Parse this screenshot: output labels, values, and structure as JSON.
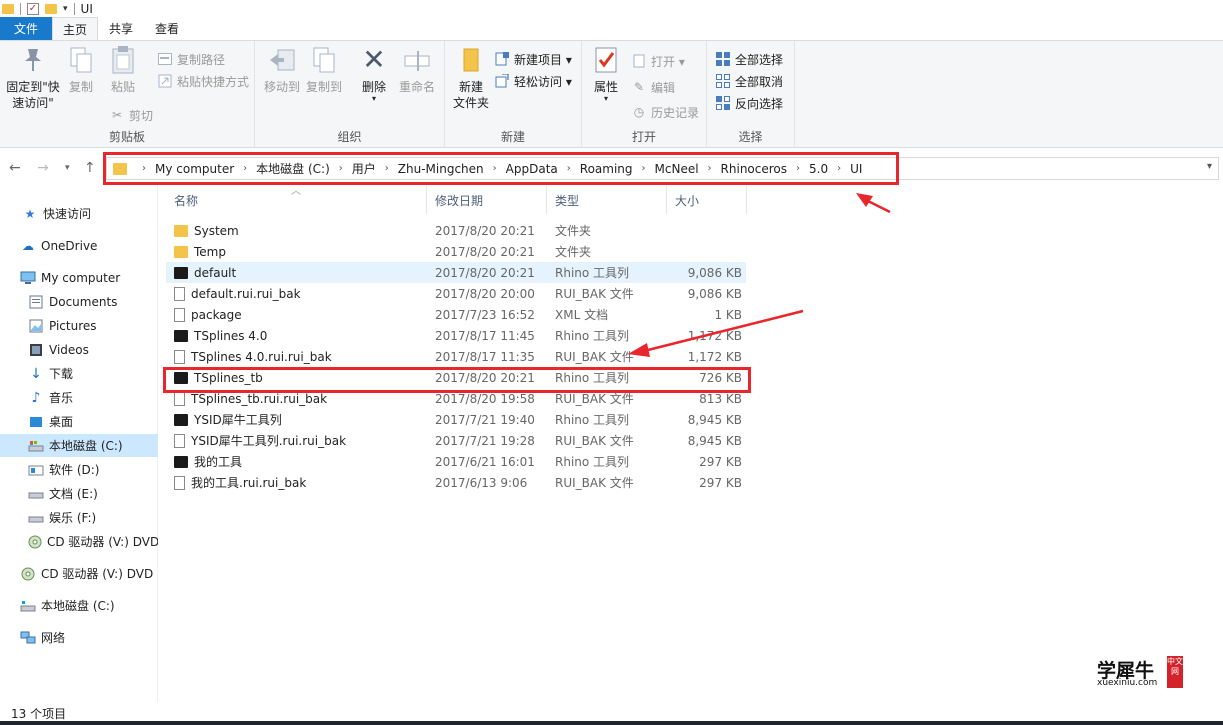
{
  "window": {
    "title": "UI"
  },
  "tabs": [
    {
      "label": "文件"
    },
    {
      "label": "主页"
    },
    {
      "label": "共享"
    },
    {
      "label": "查看"
    }
  ],
  "ribbon": {
    "clipboard": {
      "label": "剪贴板",
      "pin_line1": "固定到\"快",
      "pin_line2": "速访问\"",
      "copy": "复制",
      "paste": "粘贴",
      "copy_path": "复制路径",
      "paste_shortcut": "粘贴快捷方式",
      "cut": "剪切"
    },
    "organize": {
      "label": "组织",
      "move_to": "移动到",
      "copy_to": "复制到",
      "delete": "删除",
      "rename": "重命名"
    },
    "new": {
      "label": "新建",
      "new_folder_line1": "新建",
      "new_folder_line2": "文件夹",
      "new_item": "新建项目 ▾",
      "easy_access": "轻松访问 ▾"
    },
    "open": {
      "label": "打开",
      "properties": "属性",
      "open": "打开 ▾",
      "edit": "编辑",
      "history": "历史记录"
    },
    "select": {
      "label": "选择",
      "select_all": "全部选择",
      "select_none": "全部取消",
      "invert": "反向选择"
    }
  },
  "address": {
    "crumbs": [
      "My computer",
      "本地磁盘 (C:)",
      "用户",
      "Zhu-Mingchen",
      "AppData",
      "Roaming",
      "McNeel",
      "Rhinoceros",
      "5.0",
      "UI"
    ]
  },
  "sidebar": {
    "items": [
      {
        "label": "快速访问",
        "icon": "star-icon"
      },
      {
        "label": "OneDrive",
        "icon": "cloud-icon"
      },
      {
        "label": "My computer",
        "icon": "computer-icon"
      },
      {
        "label": "Documents",
        "icon": "documents-icon"
      },
      {
        "label": "Pictures",
        "icon": "pictures-icon"
      },
      {
        "label": "Videos",
        "icon": "videos-icon"
      },
      {
        "label": "下载",
        "icon": "download-icon"
      },
      {
        "label": "音乐",
        "icon": "music-icon"
      },
      {
        "label": "桌面",
        "icon": "desktop-icon"
      },
      {
        "label": "本地磁盘 (C:)",
        "icon": "drive-icon"
      },
      {
        "label": "软件 (D:)",
        "icon": "drive-icon"
      },
      {
        "label": "文档 (E:)",
        "icon": "drive-icon"
      },
      {
        "label": "娱乐 (F:)",
        "icon": "drive-icon"
      },
      {
        "label": "CD 驱动器 (V:) DVD",
        "icon": "cd-icon"
      },
      {
        "label": "CD 驱动器 (V:) DVD",
        "icon": "cd-icon"
      },
      {
        "label": "本地磁盘 (C:)",
        "icon": "drive-icon"
      },
      {
        "label": "网络",
        "icon": "network-icon"
      }
    ]
  },
  "columns": {
    "name": "名称",
    "date": "修改日期",
    "type": "类型",
    "size": "大小"
  },
  "files": [
    {
      "name": "System",
      "date": "2017/8/20 20:21",
      "type": "文件夹",
      "size": "",
      "icon": "folder-icon"
    },
    {
      "name": "Temp",
      "date": "2017/8/20 20:21",
      "type": "文件夹",
      "size": "",
      "icon": "folder-icon"
    },
    {
      "name": "default",
      "date": "2017/8/20 20:21",
      "type": "Rhino 工具列",
      "size": "9,086 KB",
      "icon": "rhino-toolbar-icon"
    },
    {
      "name": "default.rui.rui_bak",
      "date": "2017/8/20 20:00",
      "type": "RUI_BAK 文件",
      "size": "9,086 KB",
      "icon": "file-icon"
    },
    {
      "name": "package",
      "date": "2017/7/23 16:52",
      "type": "XML 文档",
      "size": "1 KB",
      "icon": "file-icon"
    },
    {
      "name": "TSplines 4.0",
      "date": "2017/8/17 11:45",
      "type": "Rhino 工具列",
      "size": "1,172 KB",
      "icon": "rhino-toolbar-icon"
    },
    {
      "name": "TSplines 4.0.rui.rui_bak",
      "date": "2017/8/17 11:35",
      "type": "RUI_BAK 文件",
      "size": "1,172 KB",
      "icon": "file-icon"
    },
    {
      "name": "TSplines_tb",
      "date": "2017/8/20 20:21",
      "type": "Rhino 工具列",
      "size": "726 KB",
      "icon": "rhino-toolbar-icon"
    },
    {
      "name": "TSplines_tb.rui.rui_bak",
      "date": "2017/8/20 19:58",
      "type": "RUI_BAK 文件",
      "size": "813 KB",
      "icon": "file-icon"
    },
    {
      "name": "YSID犀牛工具列",
      "date": "2017/7/21 19:40",
      "type": "Rhino 工具列",
      "size": "8,945 KB",
      "icon": "rhino-toolbar-icon"
    },
    {
      "name": "YSID犀牛工具列.rui.rui_bak",
      "date": "2017/7/21 19:28",
      "type": "RUI_BAK 文件",
      "size": "8,945 KB",
      "icon": "file-icon"
    },
    {
      "name": "我的工具",
      "date": "2017/6/21 16:01",
      "type": "Rhino 工具列",
      "size": "297 KB",
      "icon": "rhino-toolbar-icon"
    },
    {
      "name": "我的工具.rui.rui_bak",
      "date": "2017/6/13 9:06",
      "type": "RUI_BAK 文件",
      "size": "297 KB",
      "icon": "file-icon"
    }
  ],
  "status": {
    "count": "13 个项目"
  },
  "watermark": {
    "text": "学犀牛",
    "url": "xuexiniu.com",
    "badge": "中文网"
  },
  "colors": {
    "accent": "#1979ca",
    "annotation": "#e8262c",
    "folder": "#f3c34a",
    "selection": "#cce8ff"
  }
}
